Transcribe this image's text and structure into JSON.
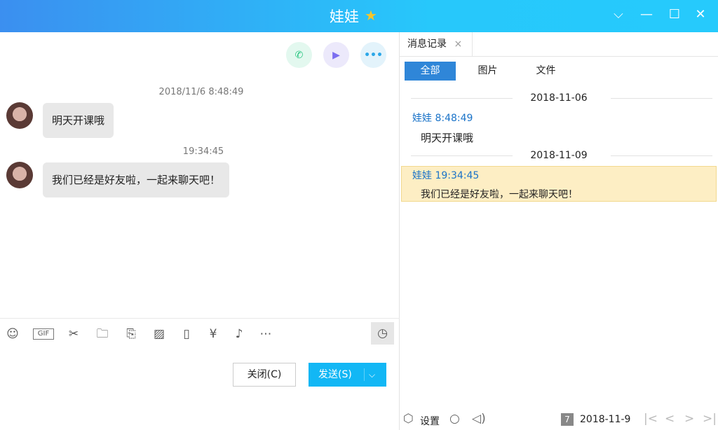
{
  "window": {
    "title": "娃娃",
    "vip_icon": "star-badge-icon"
  },
  "window_buttons": [
    "chevron-down-icon",
    "minimize-icon",
    "maximize-icon",
    "close-icon"
  ],
  "chat": {
    "actions": [
      "phone-icon",
      "video-icon",
      "more-icon"
    ],
    "messages": [
      {
        "timestamp": "2018/11/6 8:48:49",
        "text": "明天开课哦"
      },
      {
        "timestamp": "19:34:45",
        "text": "我们已经是好友啦，一起来聊天吧！"
      }
    ],
    "toolbar_icons": [
      "emoji-icon",
      "gif-icon",
      "scissors-icon",
      "folder-icon",
      "file-transfer-icon",
      "image-icon",
      "shake-icon",
      "red-packet-icon",
      "music-icon",
      "more-icon",
      "history-icon"
    ],
    "close_label": "关闭(C)",
    "send_label": "发送(S)"
  },
  "history": {
    "tab_label": "消息记录",
    "filters": [
      "全部",
      "图片",
      "文件"
    ],
    "groups": [
      {
        "date": "2018-11-06",
        "sender": "娃娃 8:48:49",
        "text": "明天开课哦"
      },
      {
        "date": "2018-11-09",
        "sender": "娃娃 19:34:45",
        "text": "我们已经是好友啦，一起来聊天吧！"
      }
    ],
    "settings_label": "设置",
    "current_date": "2018-11-9"
  },
  "colors": {
    "accent": "#12b7f5",
    "highlight": "#fdeec4",
    "sender": "#1a73c8"
  }
}
